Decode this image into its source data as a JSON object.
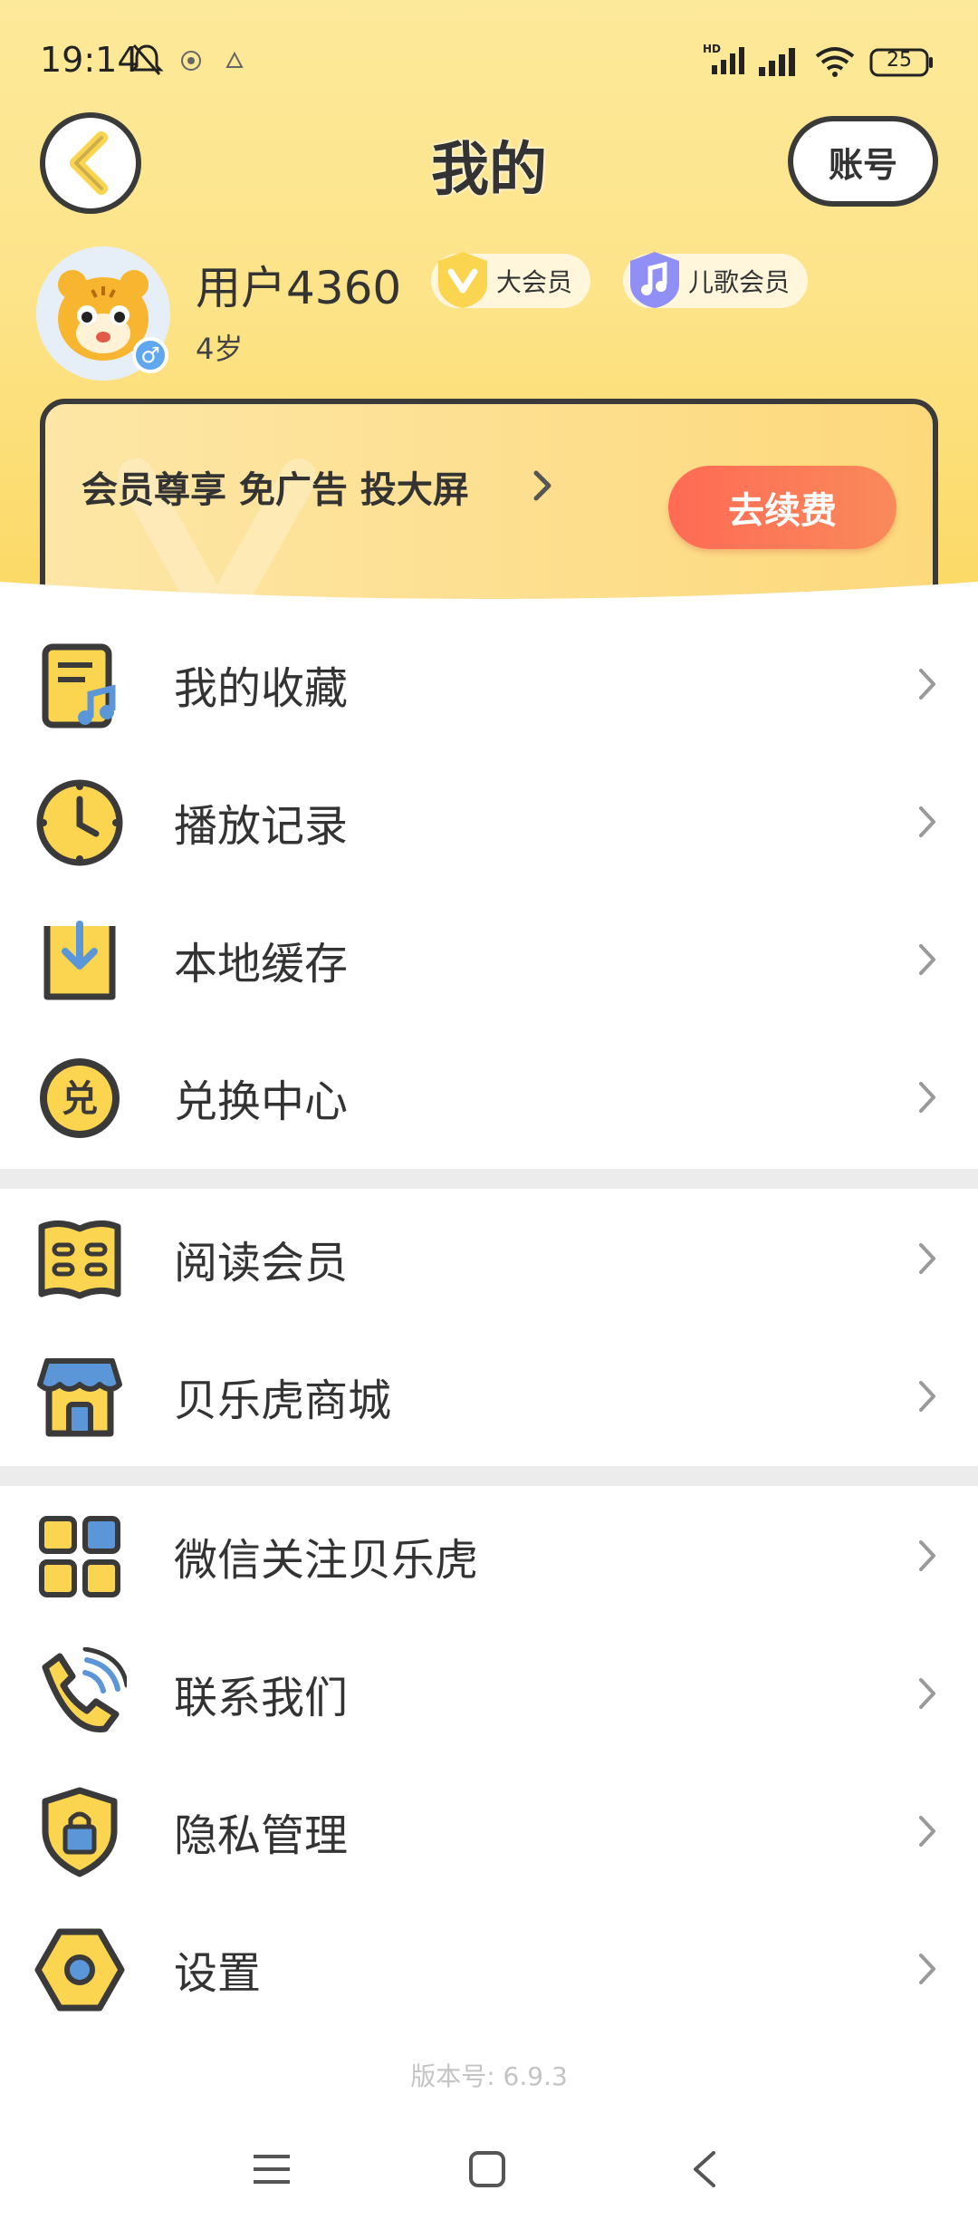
{
  "status_bar": {
    "time": "19:14",
    "battery": "25",
    "icons": [
      "bell-muted-icon",
      "app-notification-icon",
      "app-notification-icon",
      "hd-signal-icon",
      "signal-icon",
      "wifi-icon",
      "battery-icon"
    ]
  },
  "header": {
    "title": "我的",
    "account_label": "账号"
  },
  "profile": {
    "username": "用户4360",
    "age": "4岁",
    "gender": "♂",
    "badges": [
      {
        "label": "大会员",
        "icon": "v-crown-icon",
        "color": "#fcd550"
      },
      {
        "label": "儿歌会员",
        "icon": "music-note-icon",
        "color": "#8f8ff5"
      }
    ]
  },
  "promo": {
    "text": "会员尊享 免广告 投大屏",
    "button": "去续费"
  },
  "menu_groups": [
    [
      {
        "label": "我的收藏",
        "icon": "music-list-icon"
      },
      {
        "label": "播放记录",
        "icon": "clock-icon"
      },
      {
        "label": "本地缓存",
        "icon": "download-tray-icon"
      },
      {
        "label": "兑换中心",
        "icon": "redeem-icon"
      }
    ],
    [
      {
        "label": "阅读会员",
        "icon": "book-icon"
      },
      {
        "label": "贝乐虎商城",
        "icon": "store-icon"
      }
    ],
    [
      {
        "label": "微信关注贝乐虎",
        "icon": "apps-grid-icon"
      },
      {
        "label": "联系我们",
        "icon": "phone-icon"
      },
      {
        "label": "隐私管理",
        "icon": "shield-lock-icon"
      },
      {
        "label": "设置",
        "icon": "settings-hex-icon"
      }
    ]
  ],
  "version": "版本号: 6.9.3",
  "colors": {
    "accent_yellow": "#fcd550",
    "outline": "#3a3a3a",
    "renew_red": "#ff6a55",
    "icon_blue": "#5b97d8"
  }
}
